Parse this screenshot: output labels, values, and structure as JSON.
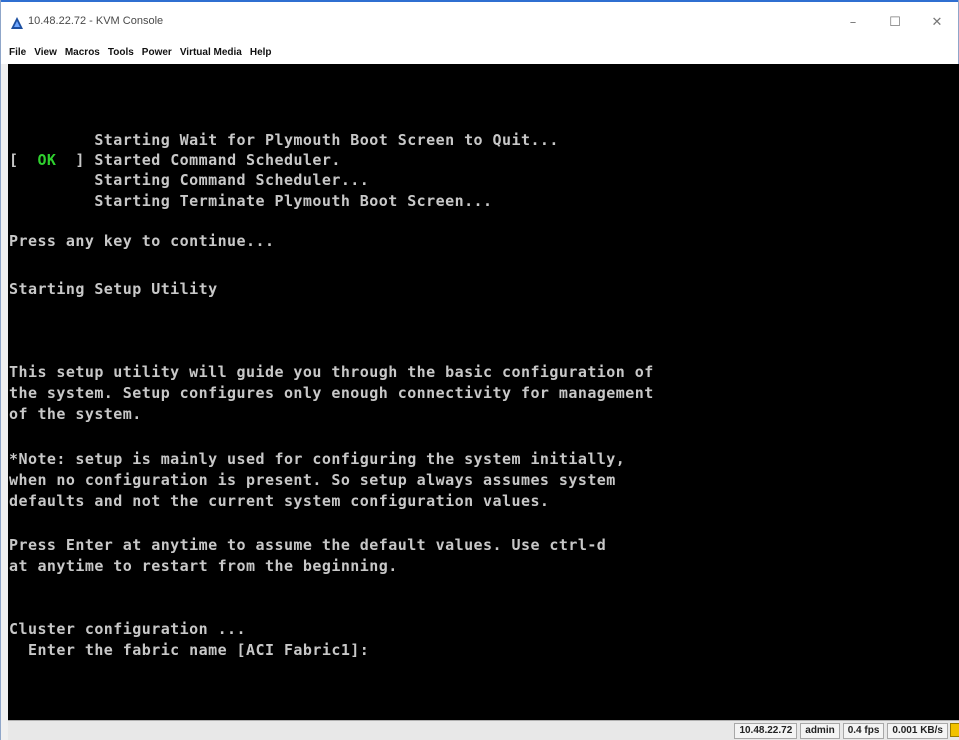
{
  "window": {
    "title": "10.48.22.72 - KVM Console",
    "controls": {
      "minimize": "–",
      "maximize": "☐",
      "close": "✕"
    }
  },
  "menu": {
    "items": [
      "File",
      "View",
      "Macros",
      "Tools",
      "Power",
      "Virtual Media",
      "Help"
    ]
  },
  "console": {
    "lines": [
      {
        "prefix": "",
        "status": "",
        "text": "         Starting Wait for Plymouth Boot Screen to Quit..."
      },
      {
        "prefix": "[  ",
        "status": "OK",
        "text": "  ] Started Command Scheduler."
      },
      {
        "prefix": "",
        "status": "",
        "text": "         Starting Command Scheduler..."
      },
      {
        "prefix": "",
        "status": "",
        "text": "         Starting Terminate Plymouth Boot Screen..."
      },
      {
        "prefix": "",
        "status": "",
        "text": ""
      },
      {
        "prefix": "",
        "status": "",
        "text": "Press any key to continue..."
      },
      {
        "prefix": "",
        "status": "",
        "text": ""
      },
      {
        "prefix": "",
        "status": "",
        "text": "Starting Setup Utility"
      },
      {
        "prefix": "",
        "status": "",
        "text": ""
      },
      {
        "prefix": "",
        "status": "",
        "text": ""
      },
      {
        "prefix": "",
        "status": "",
        "text": ""
      },
      {
        "prefix": "",
        "status": "",
        "text": "This setup utility will guide you through the basic configuration of"
      },
      {
        "prefix": "",
        "status": "",
        "text": "the system. Setup configures only enough connectivity for management"
      },
      {
        "prefix": "",
        "status": "",
        "text": "of the system."
      },
      {
        "prefix": "",
        "status": "",
        "text": ""
      },
      {
        "prefix": "",
        "status": "",
        "text": "*Note: setup is mainly used for configuring the system initially,"
      },
      {
        "prefix": "",
        "status": "",
        "text": "when no configuration is present. So setup always assumes system"
      },
      {
        "prefix": "",
        "status": "",
        "text": "defaults and not the current system configuration values."
      },
      {
        "prefix": "",
        "status": "",
        "text": ""
      },
      {
        "prefix": "",
        "status": "",
        "text": "Press Enter at anytime to assume the default values. Use ctrl-d"
      },
      {
        "prefix": "",
        "status": "",
        "text": "at anytime to restart from the beginning."
      },
      {
        "prefix": "",
        "status": "",
        "text": ""
      },
      {
        "prefix": "",
        "status": "",
        "text": ""
      },
      {
        "prefix": "",
        "status": "",
        "text": "Cluster configuration ..."
      },
      {
        "prefix": "",
        "status": "",
        "text": "  Enter the fabric name [ACI Fabric1]:"
      }
    ]
  },
  "statusbar": {
    "host": "10.48.22.72",
    "user": "admin",
    "fps": "0.4 fps",
    "rate": "0.001 KB/s"
  },
  "colors": {
    "console_bg": "#000000",
    "console_text": "#c8c8c8",
    "ok_green": "#2fd12f",
    "titlebar_accent": "#2f6fd1"
  }
}
